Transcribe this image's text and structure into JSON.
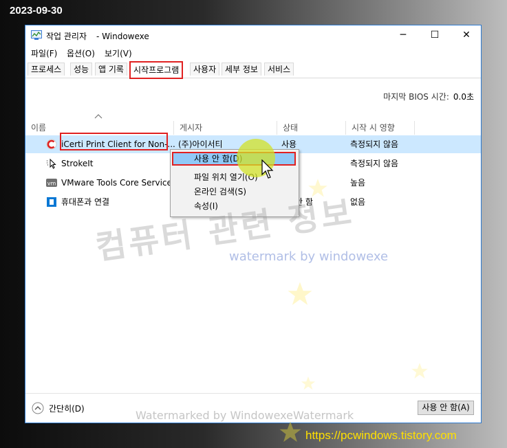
{
  "overlay": {
    "date": "2023-09-30",
    "site_url": "https://pcwindows.tistory.com",
    "watermark_korean": "컴퓨터 관련 정보",
    "watermark_en": "watermark by windowexe",
    "watermark_bottom": "Watermarked by WindowexeWatermark"
  },
  "window": {
    "title": "작업 관리자",
    "app_name": "- Windowexe",
    "controls": {
      "minimize": "─",
      "maximize": "☐",
      "close": "✕"
    }
  },
  "menu": [
    "파일(F)",
    "옵션(O)",
    "보기(V)"
  ],
  "tabs": [
    {
      "label": "프로세스"
    },
    {
      "label": "성능"
    },
    {
      "label": "앱 기록"
    },
    {
      "label": "시작프로그램",
      "active": true
    },
    {
      "label": "사용자"
    },
    {
      "label": "세부 정보"
    },
    {
      "label": "서비스"
    }
  ],
  "bios": {
    "label": "마지막 BIOS 시간:",
    "value": "0.0초"
  },
  "columns": {
    "name": "이름",
    "publisher": "게시자",
    "status": "상태",
    "impact": "시작 시 영향"
  },
  "rows": [
    {
      "name": "iCerti Print Client for Non-...",
      "publisher": "(주)아이서티",
      "status": "사용",
      "impact": "측정되지 않음",
      "icon": "icerti-icon"
    },
    {
      "name": "StrokeIt",
      "publisher": "",
      "status": "",
      "impact": "측정되지 않음",
      "icon": "strokeit-icon"
    },
    {
      "name": "VMware Tools Core Service",
      "publisher": "",
      "status": "",
      "impact": "높음",
      "icon": "vmware-icon"
    },
    {
      "name": "휴대폰과 연결",
      "publisher": "",
      "status": "안 함",
      "impact": "없음",
      "icon": "phone-link-icon"
    }
  ],
  "context_menu": [
    "사용 안 함(D)",
    "파일 위치 열기(O)",
    "온라인 검색(S)",
    "속성(I)"
  ],
  "footer": {
    "collapse_label": "간단히(D)",
    "disable_button": "사용 안 함(A)"
  },
  "colors": {
    "selected_row": "#cce8ff",
    "highlight_box": "#e02020",
    "site_url": "#ffe000"
  }
}
